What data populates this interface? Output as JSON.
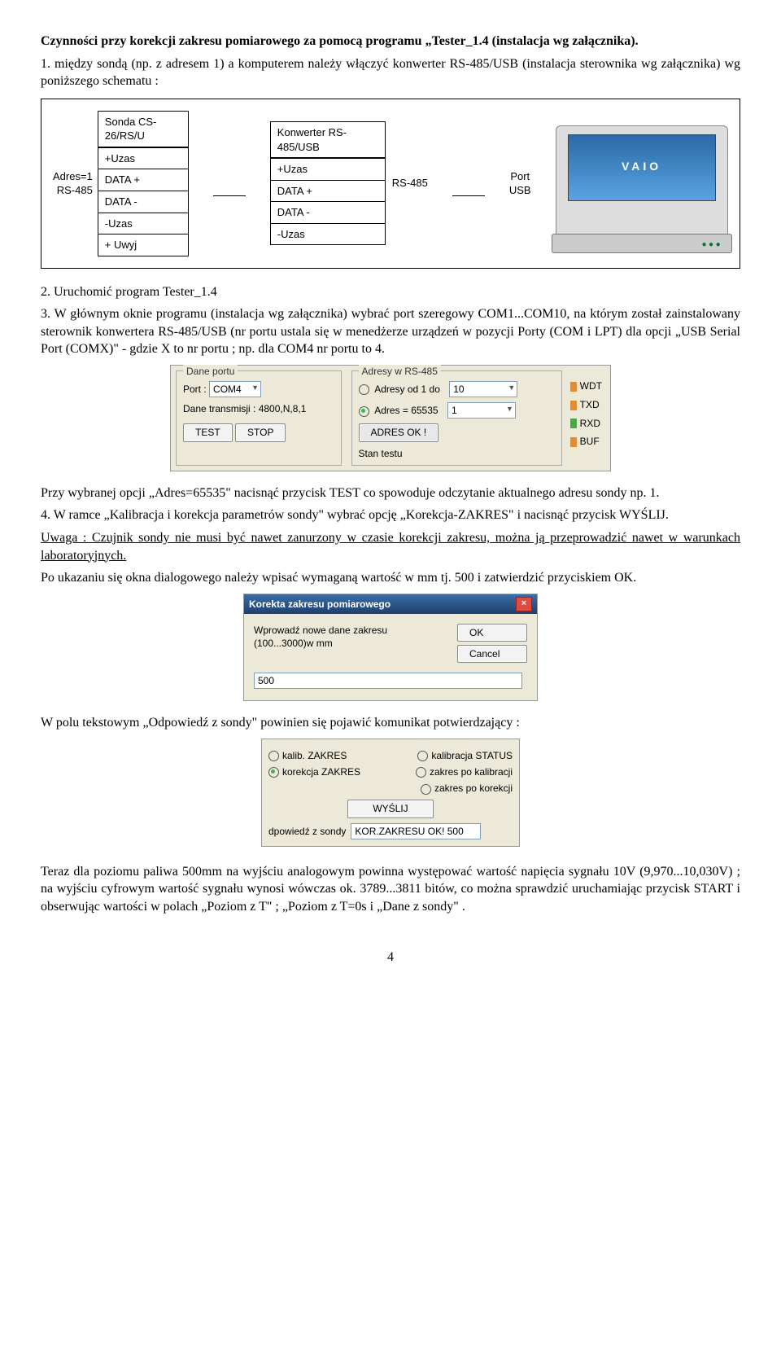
{
  "section_title_line1": "Czynności przy korekcji zakresu pomiarowego za pomocą programu „Tester_1.4 (instalacja wg załącznika).",
  "step1": "1.  między sondą (np. z adresem 1) a komputerem należy włączyć konwerter RS-485/USB (instalacja sterownika wg załącznika) wg poniższego schematu :",
  "diagram": {
    "box1_title": "Sonda CS-26/RS/U",
    "box1_rows": [
      "+Uzas",
      "DATA +",
      "DATA -",
      "-Uzas",
      "+ Uwyj"
    ],
    "box1_side1": "Adres=1",
    "box1_side2": "RS-485",
    "box2_title": "Konwerter RS-485/USB",
    "box2_rows": [
      "+Uzas",
      "DATA +",
      "DATA -",
      "-Uzas"
    ],
    "box2_side": "RS-485",
    "port_label1": "Port",
    "port_label2": "USB",
    "laptop_logo": "VAIO"
  },
  "step2": "2.  Uruchomić program Tester_1.4",
  "step3": "3.  W głównym oknie programu (instalacja wg załącznika) wybrać port szeregowy COM1...COM10, na którym został zainstalowany sterownik konwertera RS-485/USB (nr portu ustala się w menedżerze urządzeń w pozycji Porty (COM i LPT) dla opcji „USB Serial Port (COMX)\" - gdzie X to nr portu ; np. dla COM4 nr portu to 4.",
  "dlg1": {
    "grp_port": "Dane portu",
    "port_label": "Port :",
    "port_val": "COM4",
    "trans_label": "Dane transmisji : 4800,N,8,1",
    "grp_adr": "Adresy w RS-485",
    "r_from": "Adresy od 1 do",
    "r_from_val": "10",
    "r_eq": "Adres = 65535",
    "r_eq_val": "1",
    "btn_test": "TEST",
    "btn_stop": "STOP",
    "stan": "Stan testu",
    "adr_ok": "ADRES OK !",
    "wdt": "WDT",
    "txd": "TXD",
    "rxd": "RXD",
    "buf": "BUF"
  },
  "after_dlg1_a": "Przy wybranej opcji „Adres=65535\" nacisnąć przycisk TEST co spowoduje odczytanie aktualnego adresu sondy np. 1.",
  "step4": "4.  W ramce „Kalibracja i korekcja parametrów sondy\" wybrać opcję „Korekcja-ZAKRES\" i nacisnąć przycisk WYŚLIJ.",
  "note_line": "Uwaga : Czujnik sondy nie musi być nawet zanurzony w czasie korekcji zakresu, można ją przeprowadzić nawet w warunkach laboratoryjnych.",
  "after_note": "Po ukazaniu się okna dialogowego należy wpisać wymaganą wartość w mm tj. 500 i zatwierdzić przyciskiem OK.",
  "dlg2": {
    "title": "Korekta zakresu pomiarowego",
    "prompt": "Wprowadź nowe dane zakresu (100...3000)w mm",
    "ok": "OK",
    "cancel": "Cancel",
    "val": "500"
  },
  "after_dlg2": "W polu tekstowym „Odpowiedź z sondy\" powinien się pojawić komunikat potwierdzający :",
  "dlg3": {
    "r1": "kalib. ZAKRES",
    "r2": "kalibracja STATUS",
    "r3": "korekcja ZAKRES",
    "r4": "zakres po kalibracji",
    "r5": "zakres po korekcji",
    "btn": "WYŚLIJ",
    "resp_label": "dpowiedź z sondy",
    "resp": "KOR.ZAKRESU OK! 500"
  },
  "final": "Teraz dla poziomu paliwa 500mm na wyjściu analogowym powinna występować wartość napięcia sygnału 10V (9,970...10,030V) ; na wyjściu cyfrowym wartość sygnału wynosi wówczas ok. 3789...3811 bitów, co można sprawdzić uruchamiając przycisk START i obserwując wartości w polach „Poziom z T\" ; „Poziom z T=0s i „Dane z sondy\" .",
  "page": "4"
}
